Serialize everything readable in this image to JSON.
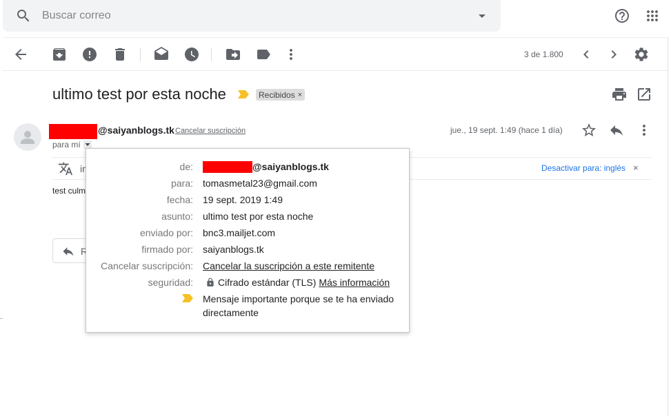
{
  "search": {
    "placeholder": "Buscar correo"
  },
  "icons": {
    "search": "search-icon",
    "dropdown": "arrow-drop-down-icon",
    "help": "help-icon",
    "apps": "apps-grid-icon",
    "back": "arrow-back-icon",
    "archive": "archive-icon",
    "spam": "report-spam-icon",
    "delete": "delete-icon",
    "mark_read": "mark-as-read-icon",
    "snooze": "snooze-icon",
    "move": "move-to-icon",
    "label": "label-icon",
    "more": "more-vert-icon",
    "prev": "chevron-left-icon",
    "next": "chevron-right-icon",
    "settings": "gear-icon",
    "print": "print-icon",
    "new_window": "open-in-new-icon",
    "star": "star-icon",
    "reply": "reply-icon",
    "translate": "translate-icon",
    "lock": "lock-icon",
    "importance": "importance-marker-icon"
  },
  "toolbar": {
    "pager": "3 de 1.800"
  },
  "message": {
    "subject": "ultimo test por esta noche",
    "label": "Recibidos",
    "label_remove": "×",
    "sender_domain": "@saiyanblogs.tk",
    "unsubscribe": "Cancelar suscripción",
    "date": "jue., 19 sept. 1:49 (hace 1 día)",
    "to": "para mí",
    "body": "test culm",
    "reply_label": "R"
  },
  "translate_bar": {
    "text": "in",
    "off_label": "Desactivar para: inglés",
    "close": "×"
  },
  "details": {
    "de_key": "de:",
    "de_value": "@saiyanblogs.tk",
    "para_key": "para:",
    "para_value": "tomasmetal23@gmail.com",
    "fecha_key": "fecha:",
    "fecha_value": "19 sept. 2019 1:49",
    "asunto_key": "asunto:",
    "asunto_value": "ultimo test por esta noche",
    "enviado_key": "enviado por:",
    "enviado_value": "bnc3.mailjet.com",
    "firmado_key": "firmado por:",
    "firmado_value": "saiyanblogs.tk",
    "cancelar_key": "Cancelar suscripción:",
    "cancelar_value": "Cancelar la suscripción a este remitente",
    "seguridad_key": "seguridad:",
    "seguridad_value": "Cifrado estándar (TLS)",
    "seguridad_link": "Más información",
    "importance_value": "Mensaje importante porque se te ha enviado directamente"
  },
  "colors": {
    "accent_blue": "#1a73e8",
    "importance_yellow": "#f6c026",
    "redaction": "#ff0000",
    "search_bg": "#f1f3f4"
  }
}
